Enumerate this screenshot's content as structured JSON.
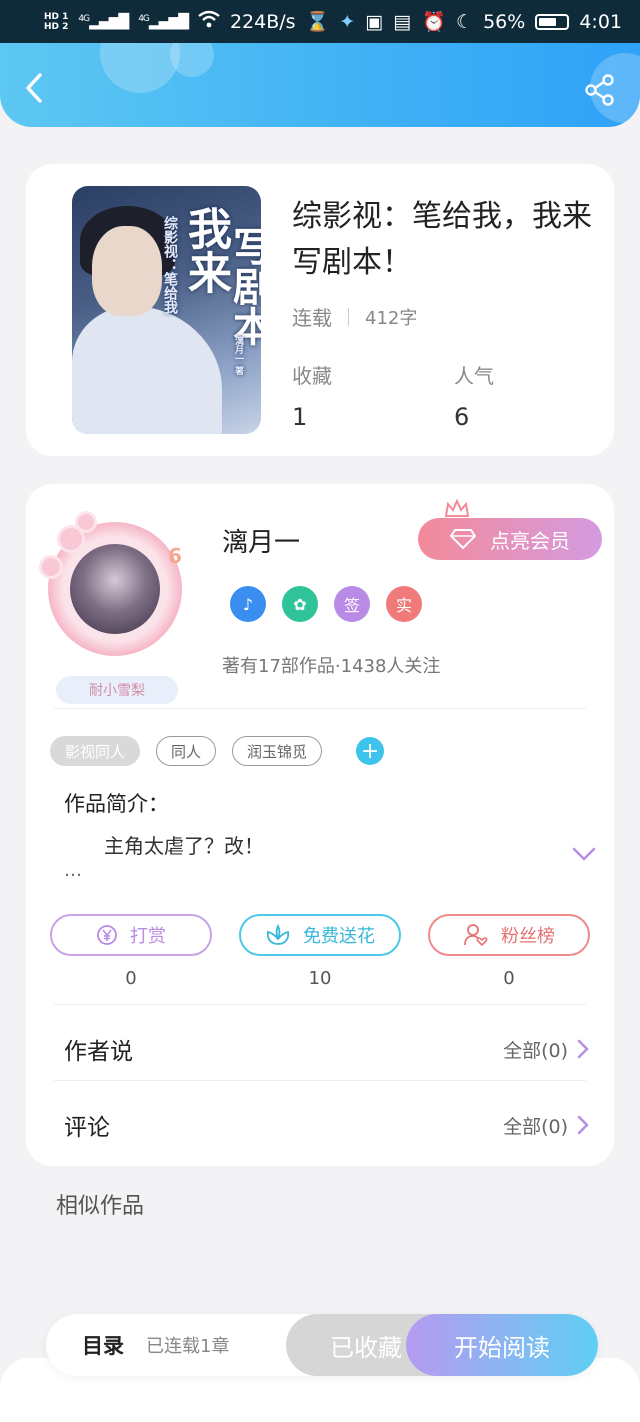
{
  "status_bar": {
    "hd1": "HD 1",
    "hd2": "HD 2",
    "net1": "4G",
    "net2": "4G",
    "speed": "224B/s",
    "battery": "56%",
    "time": "4:01"
  },
  "book": {
    "cover_title_1": "我来",
    "cover_title_2": "写剧本",
    "cover_sub": "综影视：笔给我",
    "cover_author": "漓月一 著",
    "title": "综影视：笔给我，我来写剧本！",
    "status": "连载",
    "word_count": "412字",
    "favorites_label": "收藏",
    "favorites_value": "1",
    "popularity_label": "人气",
    "popularity_value": "6"
  },
  "author": {
    "level": "6",
    "pendant_name": "耐小雪梨",
    "name": "漓月一",
    "vip_button": "点亮会员",
    "badges": [
      {
        "name": "music-badge-icon",
        "text": "♪",
        "color": "#3a8ef0"
      },
      {
        "name": "handshake-badge-icon",
        "text": "✿",
        "color": "#2fc39a"
      },
      {
        "name": "sign-badge-icon",
        "text": "签",
        "color": "#b98ae6"
      },
      {
        "name": "realname-badge-icon",
        "text": "实",
        "color": "#f07a7a"
      }
    ],
    "works_line": "著有17部作品·1438人关注"
  },
  "tags": [
    "影视同人",
    "同人",
    "润玉锦觅"
  ],
  "intro": {
    "title": "作品简介：",
    "text": "主角太虐了？改！",
    "more": "…"
  },
  "actions": [
    {
      "label": "打赏",
      "count": "0",
      "color": "#c7a3e8",
      "icon": "yuan-icon"
    },
    {
      "label": "免费送花",
      "count": "10",
      "color": "#4cc9e6",
      "icon": "flower-icon"
    },
    {
      "label": "粉丝榜",
      "count": "0",
      "color": "#ef8a8a",
      "icon": "fan-icon"
    }
  ],
  "rows": {
    "author_says": {
      "title": "作者说",
      "all": "全部(0)"
    },
    "comments": {
      "title": "评论",
      "all": "全部(0)"
    }
  },
  "similar_title": "相似作品",
  "bottom": {
    "toc": "目录",
    "toc_status": "已连载1章",
    "collected": "已收藏",
    "read": "开始阅读"
  }
}
